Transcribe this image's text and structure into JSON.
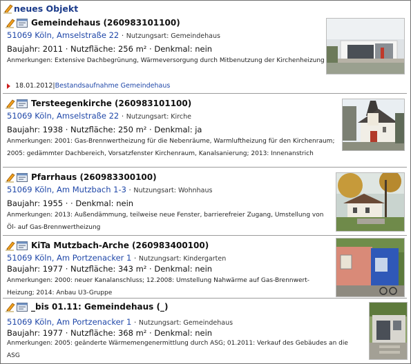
{
  "header": {
    "title": "neues Objekt",
    "icon": "pencil-icon"
  },
  "entries": [
    {
      "title": "Gemeindehaus (260983101100)",
      "address": "51069 Köln, Amselstraße 22",
      "sep": " · ",
      "usage": "Nutzungsart: Gemeindehaus",
      "meta": "Baujahr: 2011 · Nutzfläche: 256 m² · Denkmal: nein",
      "notes": "Anmerkungen: Extensive Dachbegrünung, Wärmeversorgung durch Mitbenutzung der Kirchenheizung",
      "history": {
        "date": "18.01.2012",
        "sep": " | ",
        "label": "Bestandsaufnahme Gemeindehaus"
      },
      "photo": "community-hall-photo"
    },
    {
      "title": "Tersteegenkirche (260983101100)",
      "address": "51069 Köln, Amselstraße 22",
      "sep": " · ",
      "usage": "Nutzungsart: Kirche",
      "meta": "Baujahr: 1938 · Nutzfläche: 250 m² · Denkmal: ja",
      "notes": "Anmerkungen: 2001: Gas-Brennwertheizung für die Nebenräume, Warmluftheizung für den Kirchenraum; 2005: gedämmter Dachbereich, Vorsatzfenster Kirchenraum, Kanalsanierung; 2013: Innenanstrich",
      "photo": "church-photo"
    },
    {
      "title": "Pfarrhaus (260983300100)",
      "address": "51069 Köln, Am Mutzbach 1-3",
      "sep": " · ",
      "usage": "Nutzungsart: Wohnhaus",
      "meta": "Baujahr: 1955 · · Denkmal: nein",
      "notes": "Anmerkungen: 2013: Außendämmung, teilweise neue Fenster, barrierefreier Zugang, Umstellung von Öl- auf Gas-Brennwertheizung",
      "photo": "parsonage-photo"
    },
    {
      "title": "KiTa Mutzbach-Arche (260983400100)",
      "address": "51069 Köln, Am Portzenacker 1",
      "sep": " · ",
      "usage": "Nutzungsart: Kindergarten",
      "meta": "Baujahr: 1977 · Nutzfläche: 343 m² · Denkmal: nein",
      "notes": "Anmerkungen: 2000: neuer Kanalanschluss; 12.2008: Umstellung Nahwärme auf Gas-Brennwert-Heizung; 2014: Anbau U3-Gruppe",
      "photo": "kindergarten-photo"
    },
    {
      "title": "_bis 01.11: Gemeindehaus (_)",
      "address": "51069 Köln, Am Portzenacker 1",
      "sep": " · ",
      "usage": "Nutzungsart: Gemeindehaus",
      "meta": "Baujahr: 1977 · Nutzfläche: 368 m² · Denkmal: nein",
      "notes": "Anmerkungen: 2005: geänderte Wärmemengenermittlung durch ASG; 01.2011: Verkauf des Gebäudes an die ASG",
      "photo": "old-community-hall-photo"
    }
  ],
  "colors": {
    "link": "#1f47a8",
    "header": "#1a3a8a",
    "history_arrow": "#cc1f1f",
    "divider": "#9a9a9a"
  }
}
